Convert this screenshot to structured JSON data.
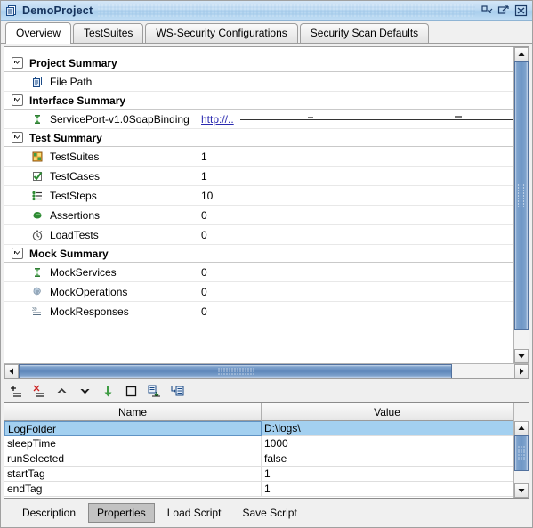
{
  "window": {
    "title": "DemoProject",
    "icon": "project-document-icon",
    "buttons": [
      {
        "name": "minimize-button",
        "glyph": "minimize"
      },
      {
        "name": "maximize-button",
        "glyph": "maximize"
      },
      {
        "name": "close-button",
        "glyph": "close"
      }
    ]
  },
  "tabs": [
    {
      "label": "Overview",
      "selected": true
    },
    {
      "label": "TestSuites",
      "selected": false
    },
    {
      "label": "WS-Security Configurations",
      "selected": false
    },
    {
      "label": "Security Scan Defaults",
      "selected": false
    }
  ],
  "summary": {
    "sections": [
      {
        "title": "Project Summary",
        "toggle": "collapse-toggle",
        "items": [
          {
            "icon": "project-document-icon",
            "label": "File Path",
            "value": ""
          }
        ]
      },
      {
        "title": "Interface Summary",
        "toggle": "collapse-toggle",
        "items": [
          {
            "icon": "interface-binding-icon",
            "label": "ServicePort-v1.0SoapBinding",
            "value": "",
            "link": "http://.."
          }
        ]
      },
      {
        "title": "Test Summary",
        "toggle": "collapse-toggle",
        "items": [
          {
            "icon": "testsuite-icon",
            "label": "TestSuites",
            "value": "1"
          },
          {
            "icon": "testcase-icon",
            "label": "TestCases",
            "value": "1"
          },
          {
            "icon": "teststep-icon",
            "label": "TestSteps",
            "value": "10"
          },
          {
            "icon": "assertion-icon",
            "label": "Assertions",
            "value": "0"
          },
          {
            "icon": "loadtest-icon",
            "label": "LoadTests",
            "value": "0"
          }
        ]
      },
      {
        "title": "Mock Summary",
        "toggle": "collapse-toggle",
        "items": [
          {
            "icon": "mockservice-icon",
            "label": "MockServices",
            "value": "0"
          },
          {
            "icon": "mockoperation-icon",
            "label": "MockOperations",
            "value": "0"
          },
          {
            "icon": "mockresponse-icon",
            "label": "MockResponses",
            "value": "0"
          }
        ]
      }
    ]
  },
  "property_toolbar": {
    "buttons": [
      {
        "name": "add-property-button",
        "icon": "add-row-icon"
      },
      {
        "name": "remove-property-button",
        "icon": "remove-row-icon"
      },
      {
        "name": "move-up-button",
        "icon": "arrow-up-icon"
      },
      {
        "name": "move-down-button",
        "icon": "arrow-down-icon"
      },
      {
        "name": "load-properties-button",
        "icon": "down-arrow-bold-icon"
      },
      {
        "name": "clear-properties-button",
        "icon": "square-icon"
      },
      {
        "name": "export-properties-button",
        "icon": "export-icon"
      },
      {
        "name": "import-properties-button",
        "icon": "import-icon"
      }
    ]
  },
  "property_table": {
    "columns": [
      "Name",
      "Value"
    ],
    "rows": [
      {
        "name": "LogFolder",
        "value": "D:\\logs\\",
        "selected": true
      },
      {
        "name": "sleepTime",
        "value": "1000",
        "selected": false
      },
      {
        "name": "runSelected",
        "value": "false",
        "selected": false
      },
      {
        "name": "startTag",
        "value": "1",
        "selected": false
      },
      {
        "name": "endTag",
        "value": "1",
        "selected": false
      }
    ]
  },
  "bottom_tabs": [
    {
      "label": "Description",
      "selected": false
    },
    {
      "label": "Properties",
      "selected": true
    },
    {
      "label": "Load Script",
      "selected": false
    },
    {
      "label": "Save Script",
      "selected": false
    }
  ]
}
